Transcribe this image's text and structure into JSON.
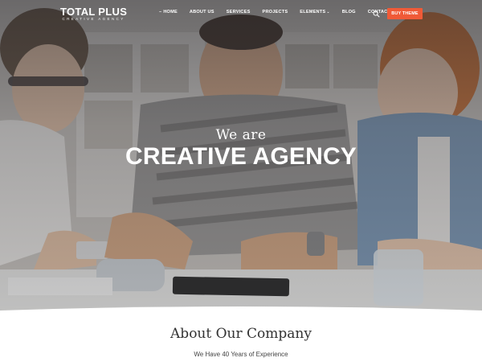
{
  "header": {
    "logo_main": "TOTAL PLUS",
    "logo_sub": "CREATIVE AGENCY",
    "nav": [
      {
        "label": "HOME",
        "active": true
      },
      {
        "label": "ABOUT US"
      },
      {
        "label": "SERVICES"
      },
      {
        "label": "PROJECTS"
      },
      {
        "label": "ELEMENTS",
        "dropdown": true
      },
      {
        "label": "BLOG"
      },
      {
        "label": "CONTACT US"
      }
    ],
    "search_icon": "search-icon",
    "cta_label": "BUY THEME",
    "cta_color": "#f05a37"
  },
  "hero": {
    "pretitle": "We are",
    "title": "CREATIVE AGENCY"
  },
  "about": {
    "title": "About Our Company",
    "subtitle": "We Have 40 Years of Experience"
  }
}
